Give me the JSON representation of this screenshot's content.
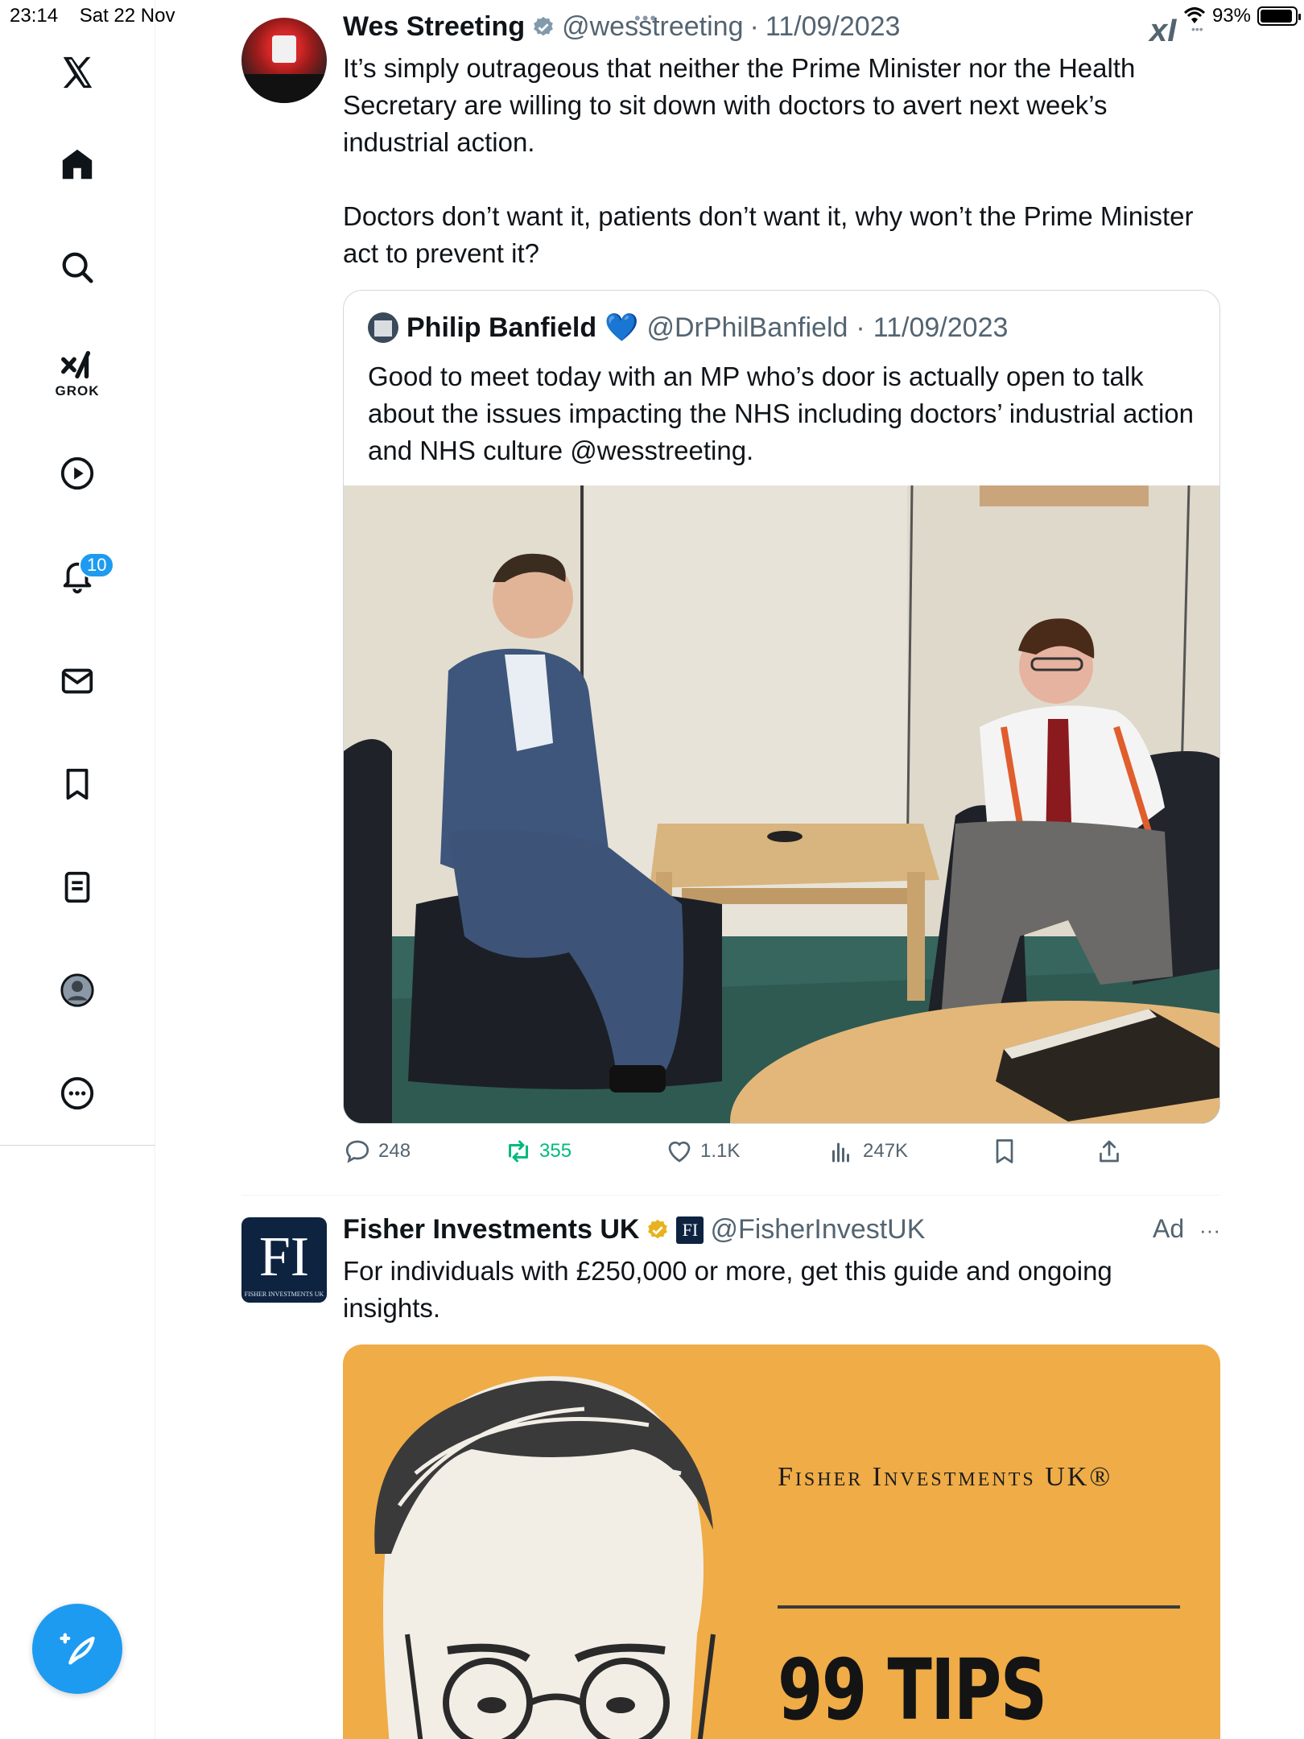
{
  "status_bar": {
    "time": "23:14",
    "date": "Sat 22 Nov",
    "battery": "93%",
    "battery_level": 0.93
  },
  "top_overlay": {
    "xai_mark": "xI"
  },
  "sidebar": {
    "items": [
      {
        "name": "x-logo",
        "icon": "x-logo-icon"
      },
      {
        "name": "home",
        "icon": "home-icon"
      },
      {
        "name": "explore",
        "icon": "search-icon"
      },
      {
        "name": "grok",
        "icon": "grok-icon",
        "label": "GROK"
      },
      {
        "name": "video",
        "icon": "play-icon"
      },
      {
        "name": "notifications",
        "icon": "bell-icon",
        "badge": "10"
      },
      {
        "name": "messages",
        "icon": "mail-icon"
      },
      {
        "name": "bookmarks",
        "icon": "bookmark-icon"
      },
      {
        "name": "lists",
        "icon": "list-icon"
      },
      {
        "name": "profile",
        "icon": "profile-icon"
      },
      {
        "name": "more",
        "icon": "more-icon"
      }
    ],
    "compose": {
      "icon": "compose-icon"
    }
  },
  "tweet": {
    "name": "Wes Streeting",
    "handle": "@wesstreeting",
    "separator": "·",
    "date": "11/09/2023",
    "text_p1": "It’s simply outrageous that neither the Prime Minister nor the Health Secretary are willing to sit down with doctors to avert next week’s industrial action.",
    "text_p2": "Doctors don’t want it, patients don’t want it, why won’t the Prime Minister act to prevent it?",
    "quote": {
      "name": "Philip Banfield",
      "emoji": "💙",
      "handle": "@DrPhilBanfield",
      "separator": "·",
      "date": "11/09/2023",
      "text": "Good to meet today with an MP who’s door is actually open to talk about the issues impacting the NHS including doctors’ industrial action and NHS culture @wesstreeting."
    },
    "actions": {
      "replies": "248",
      "reposts": "355",
      "likes": "1.1K",
      "views": "247K"
    }
  },
  "ad_tweet": {
    "name": "Fisher Investments UK",
    "handle": "@FisherInvestUK",
    "ad_label": "Ad",
    "more": "···",
    "avatar_text": "FI",
    "avatar_small": "FISHER INVESTMENTS UK",
    "mini_logo": "FI",
    "text": "For individuals with £250,000 or more, get this guide and ongoing insights.",
    "card": {
      "brand": "Fisher Investments UK®",
      "headline": "99 TIPS"
    }
  },
  "colors": {
    "accent": "#1d9bf0",
    "repost_active": "#00ba7c",
    "ad_card_bg": "#efac47",
    "verified_gold": "#e8b21f"
  }
}
